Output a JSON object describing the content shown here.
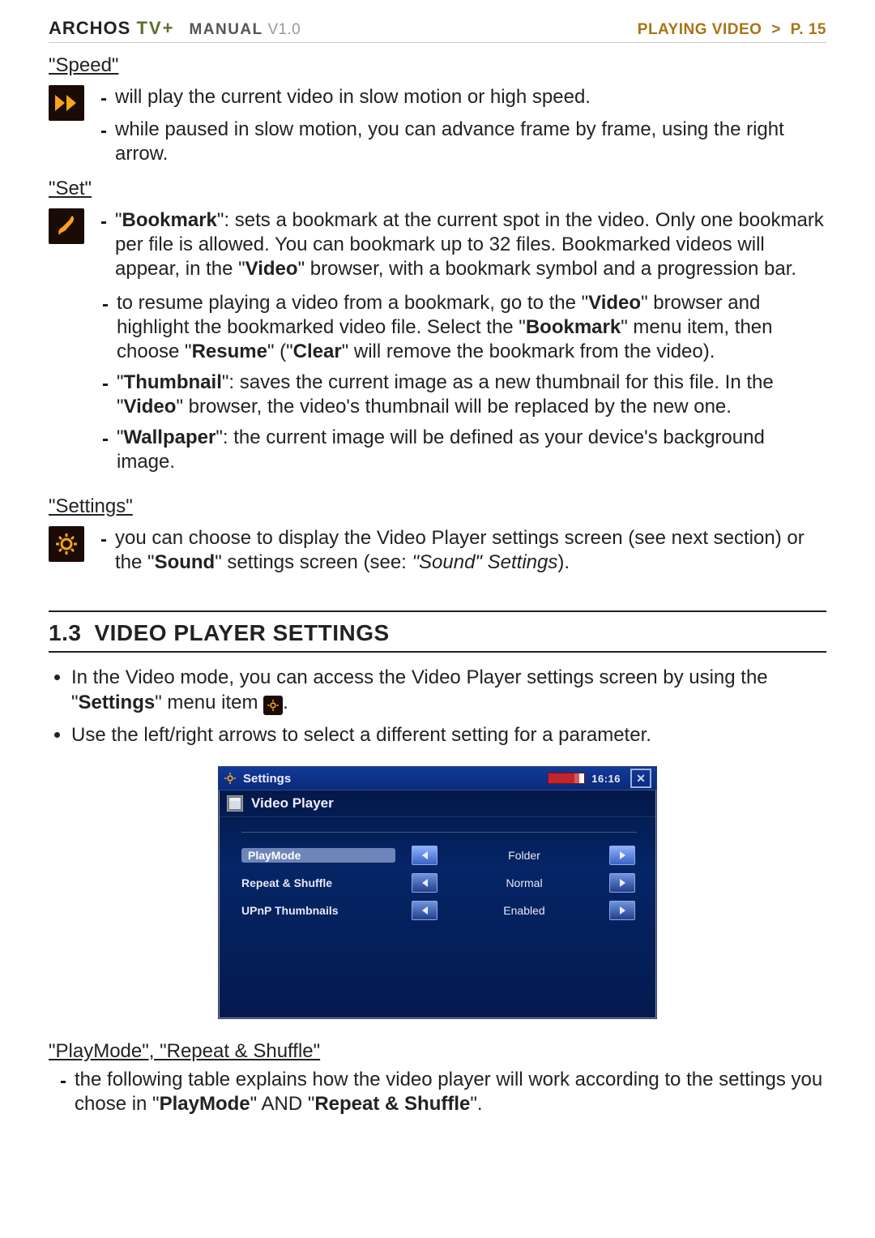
{
  "header": {
    "brand": "ARCHOS",
    "brand_sub": "TV+",
    "manual_label": "MANUAL",
    "manual_version": "V1.0",
    "section": "PLAYING VIDEO",
    "sep": ">",
    "page_label": "P. 15"
  },
  "speed": {
    "title": "\"Speed\"",
    "items": [
      "will play the current video in slow motion or high speed.",
      "while paused in slow motion, you can advance frame by frame, using the right arrow."
    ]
  },
  "set": {
    "title": "\"Set\"",
    "bookmark_pre": "\"",
    "bookmark_label": "Bookmark",
    "bookmark_text": "\": sets a bookmark at the current spot in the video. Only one bookmark per file is allowed. You can bookmark up to 32 files. Bookmarked videos will appear, in the \"",
    "video_label": "Video",
    "bookmark_text2": "\" browser, with a bookmark symbol and a progression bar.",
    "resume_text_a": "to resume playing a video from a bookmark, go to the \"",
    "resume_text_b": "\" browser and highlight the bookmarked video file. Select the \"",
    "resume_text_c": "\" menu item, then choose \"",
    "resume_label": "Resume",
    "resume_text_d": "\" (\"",
    "clear_label": "Clear",
    "resume_text_e": "\" will remove the bookmark from the video).",
    "thumb_label": "Thumbnail",
    "thumb_text_a": "\": saves the current image as a new thumbnail for this file. In the \"",
    "thumb_text_b": "\" browser, the video's thumbnail will be replaced by the new one.",
    "wall_label": "Wallpaper",
    "wall_text": "\": the current image will be defined as your device's background image."
  },
  "settings": {
    "title": "\"Settings\"",
    "text_a": "you can choose to display the Video Player settings screen (see next section) or the \"",
    "sound_label": "Sound",
    "text_b": "\" settings screen (see: ",
    "sound_ref": "\"Sound\" Settings",
    "text_c": ")."
  },
  "sec13": {
    "num": "1.3",
    "title": "Video Player Settings",
    "b1_a": "In the Video mode, you can access the Video Player settings screen by using the \"",
    "b1_label": "Settings",
    "b1_b": "\" menu item ",
    "b1_c": ".",
    "b2": "Use the left/right arrows to select a different setting for a parameter."
  },
  "screen": {
    "top_title": "Settings",
    "time": "16:16",
    "sub_title": "Video Player",
    "rows": [
      {
        "label": "PlayMode",
        "value": "Folder",
        "selected": true
      },
      {
        "label": "Repeat & Shuffle",
        "value": "Normal",
        "selected": false
      },
      {
        "label": "UPnP Thumbnails",
        "value": "Enabled",
        "selected": false
      }
    ]
  },
  "playmode": {
    "title": "\"PlayMode\", \"Repeat & Shuffle\"",
    "text_a": "the following table explains how the video player will work according to the settings you chose in \"",
    "pm_label": "PlayMode",
    "text_b": "\" AND \"",
    "rs_label": "Repeat & Shuffle",
    "text_c": "\"."
  }
}
